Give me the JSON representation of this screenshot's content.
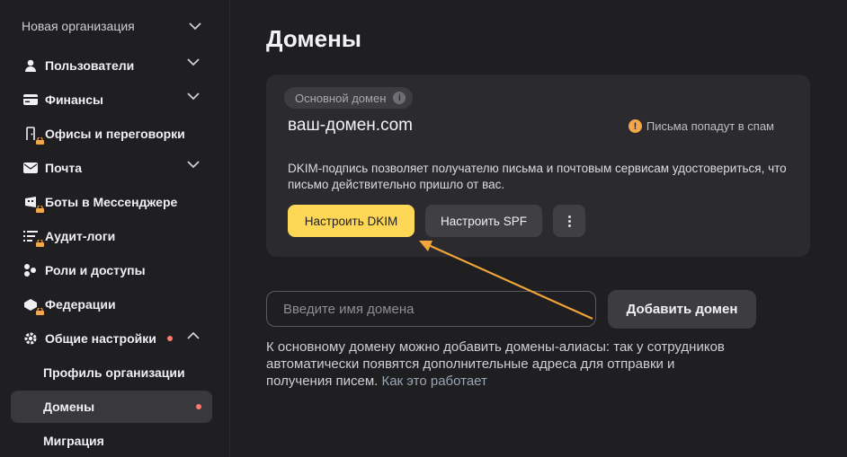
{
  "sidebar": {
    "org_name": "Новая организация",
    "items": [
      {
        "label": "Пользователи"
      },
      {
        "label": "Финансы"
      },
      {
        "label": "Офисы и переговорки"
      },
      {
        "label": "Почта"
      },
      {
        "label": "Боты в Мессенджере"
      },
      {
        "label": "Аудит-логи"
      },
      {
        "label": "Роли и доступы"
      },
      {
        "label": "Федерации"
      },
      {
        "label": "Общие настройки"
      }
    ],
    "sub_items": [
      {
        "label": "Профиль организации"
      },
      {
        "label": "Домены"
      },
      {
        "label": "Миграция"
      }
    ]
  },
  "page": {
    "title": "Домены"
  },
  "domain_card": {
    "badge": "Основной домен",
    "domain": "ваш-домен.com",
    "spam_warning": "Письма попадут в спам",
    "description": "DKIM-подпись позволяет получателю письма и почтовым сервисам удостовериться, что письмо действительно пришло от вас.",
    "dkim_button": "Настроить DKIM",
    "spf_button": "Настроить SPF"
  },
  "add_domain": {
    "placeholder": "Введите имя домена",
    "button": "Добавить домен",
    "help_text": "К основному домену можно добавить домены-алиасы: так у сотрудников автоматически появятся дополнительные адреса для отправки и получения писем.",
    "help_link": "Как это работает"
  },
  "colors": {
    "accent": "#fed756",
    "annotation_arrow": "#f0a43a",
    "notification_dot": "#ff7a6e",
    "warning": "#f3a64a"
  }
}
